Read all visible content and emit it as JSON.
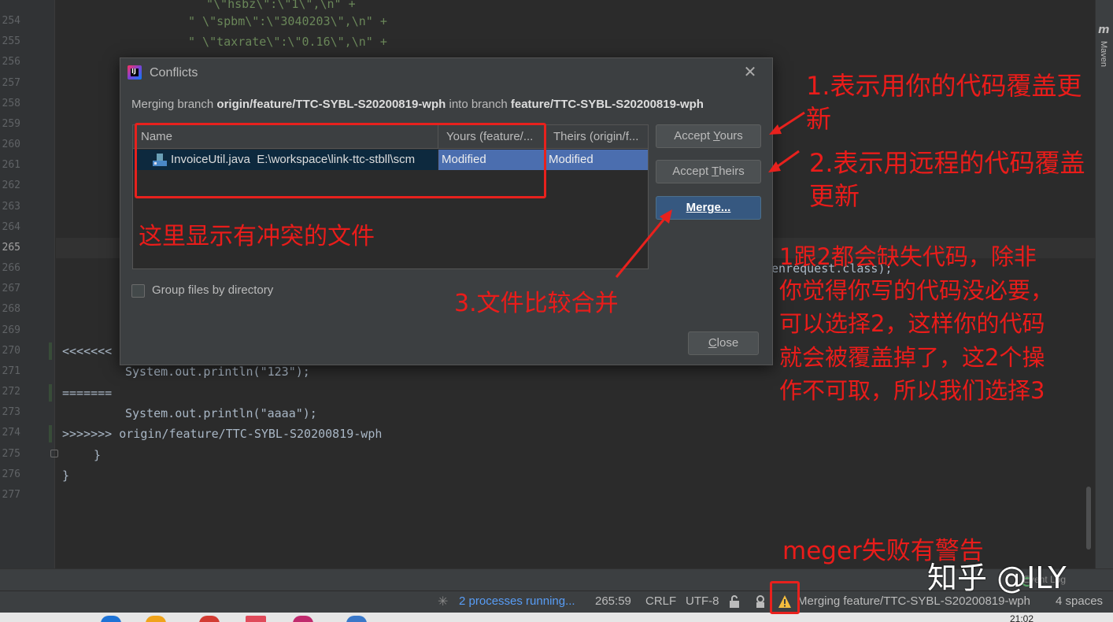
{
  "editor": {
    "line_numbers": [
      "254",
      "255",
      "256",
      "257",
      "258",
      "259",
      "260",
      "261",
      "262",
      "263",
      "264",
      "265",
      "266",
      "267",
      "268",
      "269",
      "270",
      "271",
      "272",
      "273",
      "274",
      "275",
      "276",
      "277"
    ],
    "active_line": "265",
    "top_partial_line": "\"\\\"hsbz\\\":\\\"1\\\",\\n\" +",
    "line_254": "\" \\\"spbm\\\":\\\"3040203\\\",\\n\" +",
    "line_255": "\" \\\"taxrate\\\":\\\"0.16\\\",\\n\" +",
    "line_266_tail": "enrequest.class);",
    "line_270_marker": "<<<<<<<",
    "line_271": "System.out.println(\"123\");",
    "line_272": "=======",
    "line_273": "System.out.println(\"aaaa\");",
    "line_274": ">>>>>>> origin/feature/TTC-SYBL-S20200819-wph",
    "line_275": "}",
    "line_276": "}"
  },
  "right_tool": {
    "label": "Maven"
  },
  "dialog": {
    "title": "Conflicts",
    "message_prefix": "Merging branch ",
    "from_branch": "origin/feature/TTC-SYBL-S20200819-wph",
    "message_mid": " into branch ",
    "to_branch": "feature/TTC-SYBL-S20200819-wph",
    "columns": [
      "Name",
      "Yours (feature/...",
      "Theirs (origin/f..."
    ],
    "rows": [
      {
        "file": "InvoiceUtil.java",
        "path": "E:\\workspace\\link-ttc-stbll\\scm",
        "yours": "Modified",
        "theirs": "Modified"
      }
    ],
    "group_label": "Group files by directory",
    "buttons": {
      "accept_yours_pre": "Accept ",
      "accept_yours_ul": "Y",
      "accept_yours_post": "ours",
      "accept_theirs_pre": "Accept ",
      "accept_theirs_ul": "T",
      "accept_theirs_post": "heirs",
      "merge_ul": "M",
      "merge_post": "erge...",
      "close_ul": "C",
      "close_post": "lose"
    }
  },
  "status_bar": {
    "processes": "2 processes running...",
    "position": "265:59",
    "line_sep": "CRLF",
    "encoding": "UTF-8",
    "merge_status": "Merging feature/TTC-SYBL-S20200819-wph",
    "indent": "4 spaces",
    "event_log": "Event Log",
    "clock": "21:02"
  },
  "annotations": {
    "a1": "1.表示用你的代码覆盖更\n新",
    "a2": "2.表示用远程的代码覆盖\n更新",
    "a_files": "这里显示有冲突的文件",
    "a3": "3.文件比较合并",
    "a_note": "1跟2都会缺失代码，除非\n你觉得你写的代码没必要，\n可以选择2，这样你的代码\n就会被覆盖掉了，这2个操\n作不可取，所以我们选择3",
    "a_warn": "meger失败有警告",
    "red": "#e8211d"
  },
  "watermark": "知乎 @ILY"
}
